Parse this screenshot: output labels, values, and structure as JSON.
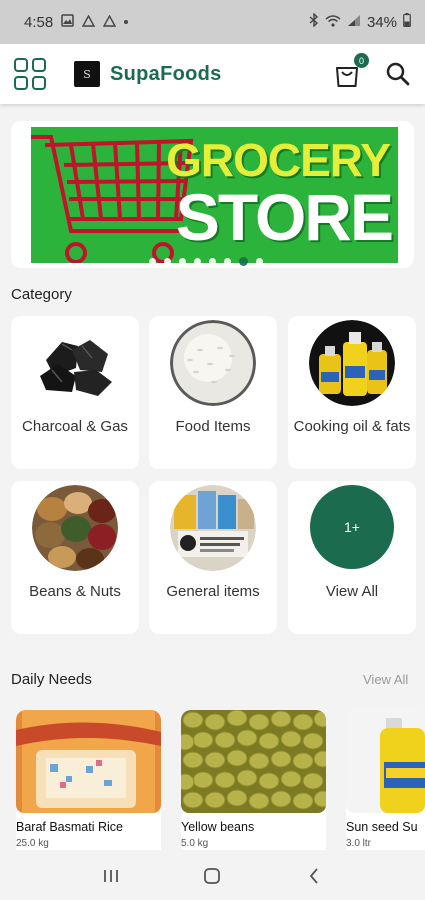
{
  "status_bar": {
    "time": "4:58",
    "battery": "34%"
  },
  "app_bar": {
    "brand": "SupaFoods",
    "cart_count": "0",
    "logo_letter": "S"
  },
  "banner": {
    "line1": "GROCERY",
    "line2": "STORE",
    "slide_count": 8,
    "active_slide": 6
  },
  "category": {
    "title": "Category",
    "items": [
      {
        "label": "Charcoal & Gas",
        "icon": "charcoal-image"
      },
      {
        "label": "Food Items",
        "icon": "rice-image"
      },
      {
        "label": "Cooking oil & fats",
        "icon": "oil-bottles-image"
      },
      {
        "label": "Beans & Nuts",
        "icon": "beans-sacks-image"
      },
      {
        "label": "General items",
        "icon": "general-items-image"
      },
      {
        "label": "View All",
        "icon_text": "1+"
      }
    ]
  },
  "daily_needs": {
    "title": "Daily Needs",
    "view_all": "View All",
    "products": [
      {
        "name": "Baraf Basmati Rice",
        "weight": "25.0 kg"
      },
      {
        "name": "Yellow beans",
        "weight": "5.0 kg"
      },
      {
        "name": "Sun seed  Su",
        "weight": "3.0 ltr"
      }
    ]
  },
  "colors": {
    "brand_green": "#1b6b4f",
    "banner_green": "#2bb33b",
    "cart_red": "#c0142b"
  }
}
